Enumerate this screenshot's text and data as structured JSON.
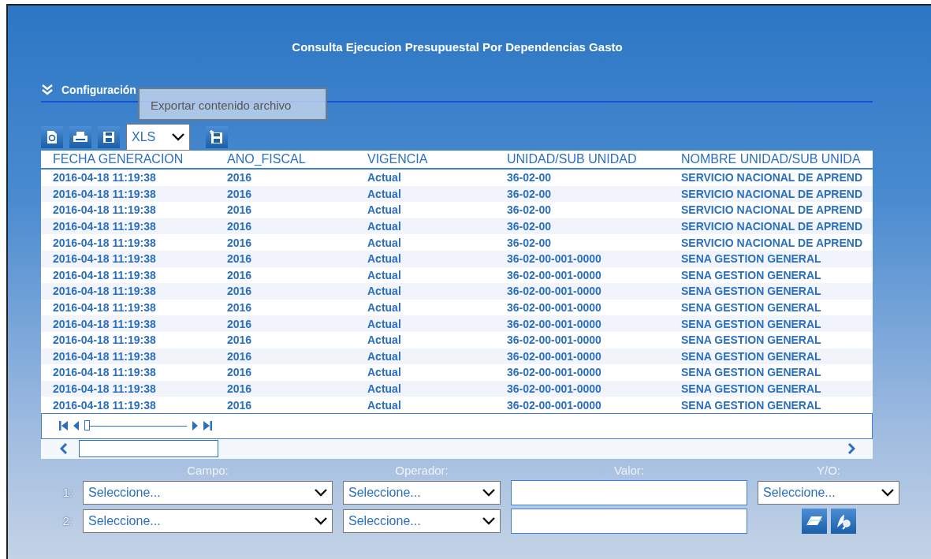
{
  "title": "Consulta Ejecucion Presupuestal Por Dependencias Gasto",
  "section": {
    "label": "Configuración",
    "expanded": true
  },
  "tooltip": "Exportar contenido archivo",
  "toolbar": {
    "format": "XLS"
  },
  "table": {
    "columns": [
      "FECHA GENERACION",
      "ANO_FISCAL",
      "VIGENCIA",
      "UNIDAD/SUB UNIDAD",
      "NOMBRE UNIDAD/SUB UNIDA"
    ],
    "rows": [
      [
        "2016-04-18 11:19:38",
        "2016",
        "Actual",
        "36-02-00",
        "SERVICIO NACIONAL DE APREND"
      ],
      [
        "2016-04-18 11:19:38",
        "2016",
        "Actual",
        "36-02-00",
        "SERVICIO NACIONAL DE APREND"
      ],
      [
        "2016-04-18 11:19:38",
        "2016",
        "Actual",
        "36-02-00",
        "SERVICIO NACIONAL DE APREND"
      ],
      [
        "2016-04-18 11:19:38",
        "2016",
        "Actual",
        "36-02-00",
        "SERVICIO NACIONAL DE APREND"
      ],
      [
        "2016-04-18 11:19:38",
        "2016",
        "Actual",
        "36-02-00",
        "SERVICIO NACIONAL DE APREND"
      ],
      [
        "2016-04-18 11:19:38",
        "2016",
        "Actual",
        "36-02-00-001-0000",
        "SENA GESTION GENERAL"
      ],
      [
        "2016-04-18 11:19:38",
        "2016",
        "Actual",
        "36-02-00-001-0000",
        "SENA GESTION GENERAL"
      ],
      [
        "2016-04-18 11:19:38",
        "2016",
        "Actual",
        "36-02-00-001-0000",
        "SENA GESTION GENERAL"
      ],
      [
        "2016-04-18 11:19:38",
        "2016",
        "Actual",
        "36-02-00-001-0000",
        "SENA GESTION GENERAL"
      ],
      [
        "2016-04-18 11:19:38",
        "2016",
        "Actual",
        "36-02-00-001-0000",
        "SENA GESTION GENERAL"
      ],
      [
        "2016-04-18 11:19:38",
        "2016",
        "Actual",
        "36-02-00-001-0000",
        "SENA GESTION GENERAL"
      ],
      [
        "2016-04-18 11:19:38",
        "2016",
        "Actual",
        "36-02-00-001-0000",
        "SENA GESTION GENERAL"
      ],
      [
        "2016-04-18 11:19:38",
        "2016",
        "Actual",
        "36-02-00-001-0000",
        "SENA GESTION GENERAL"
      ],
      [
        "2016-04-18 11:19:38",
        "2016",
        "Actual",
        "36-02-00-001-0000",
        "SENA GESTION GENERAL"
      ],
      [
        "2016-04-18 11:19:38",
        "2016",
        "Actual",
        "36-02-00-001-0000",
        "SENA GESTION GENERAL"
      ]
    ]
  },
  "pager": {
    "level": 0
  },
  "filters": {
    "labels": [
      "Campo:",
      "Operador:",
      "Valor:",
      "Y/O:"
    ],
    "rows": [
      {
        "number": "1:",
        "campo": "Seleccione...",
        "operador": "Seleccione...",
        "valor": "",
        "conector": "Seleccione..."
      },
      {
        "number": "2:",
        "campo": "Seleccione...",
        "operador": "Seleccione...",
        "valor": ""
      }
    ]
  }
}
